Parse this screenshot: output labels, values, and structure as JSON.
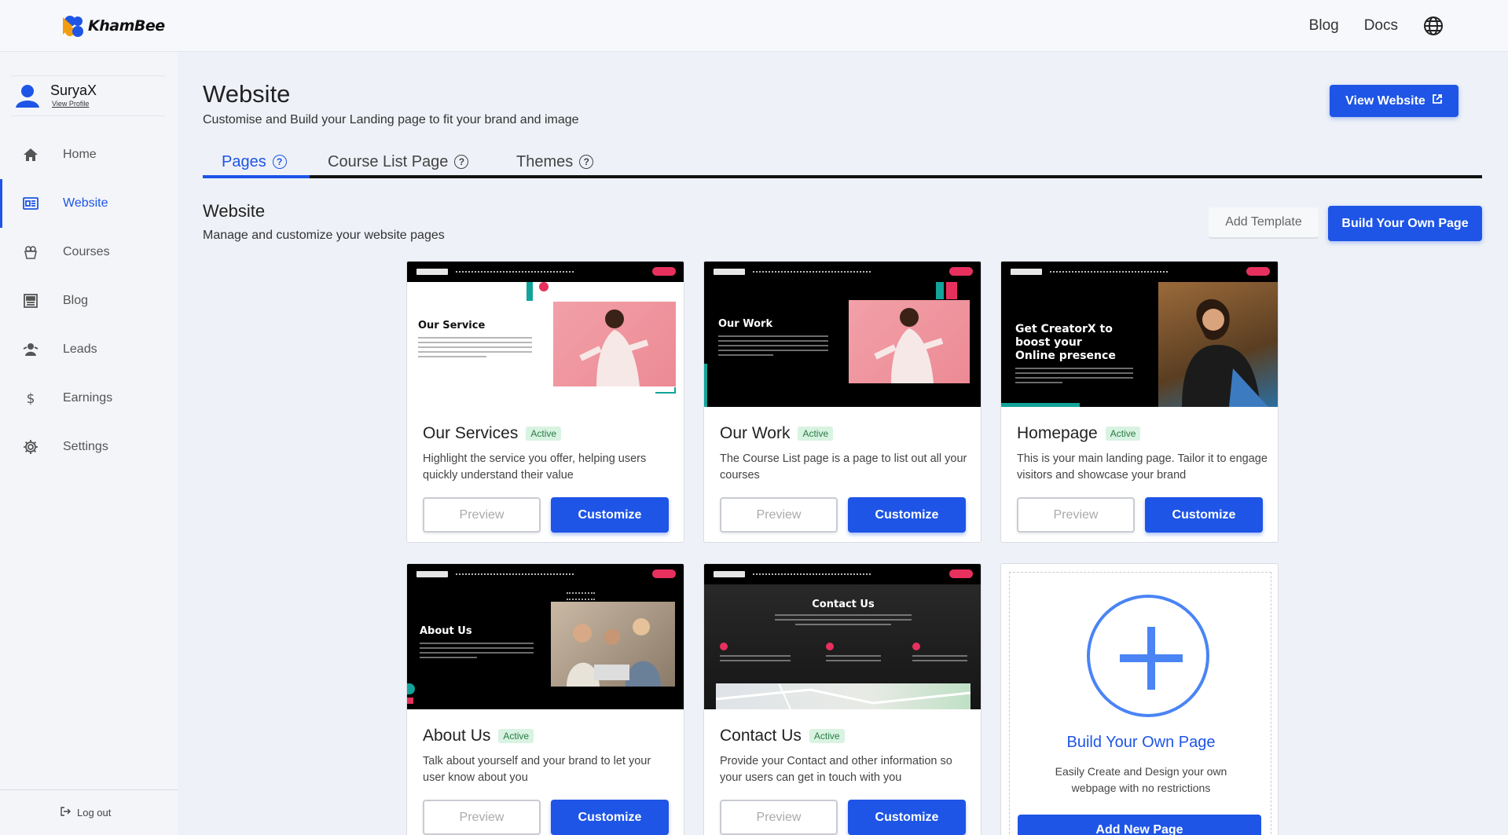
{
  "brand": {
    "name": "KhamBee"
  },
  "topnav": {
    "blog": "Blog",
    "docs": "Docs",
    "language_icon": "globe-icon"
  },
  "profile": {
    "name": "SuryaX",
    "link": "View Profile"
  },
  "sidebar": {
    "items": [
      {
        "label": "Home",
        "icon": "home-icon",
        "active": false
      },
      {
        "label": "Website",
        "icon": "website-icon",
        "active": true
      },
      {
        "label": "Courses",
        "icon": "courses-icon",
        "active": false
      },
      {
        "label": "Blog",
        "icon": "blog-icon",
        "active": false
      },
      {
        "label": "Leads",
        "icon": "leads-icon",
        "active": false
      },
      {
        "label": "Earnings",
        "icon": "dollar-icon",
        "active": false
      },
      {
        "label": "Settings",
        "icon": "gear-icon",
        "active": false
      }
    ],
    "logout": "Log out"
  },
  "header": {
    "title": "Website",
    "subtitle": "Customise and Build your Landing page to fit your brand and image",
    "view_website": "View Website"
  },
  "tabs": [
    {
      "label": "Pages",
      "active": true
    },
    {
      "label": "Course List Page",
      "active": false
    },
    {
      "label": "Themes",
      "active": false
    }
  ],
  "section": {
    "title": "Website",
    "subtitle": "Manage and customize your website pages",
    "add_template": "Add Template",
    "build_own": "Build Your Own Page"
  },
  "cards": [
    {
      "title": "Our Services",
      "badge": "Active",
      "description": "Highlight the service you offer, helping users quickly understand their value",
      "thumb_heading": "Our Service",
      "preview": "Preview",
      "customize": "Customize"
    },
    {
      "title": "Our Work",
      "badge": "Active",
      "description": "The Course List page is a page to list out all your courses",
      "thumb_heading": "Our Work",
      "preview": "Preview",
      "customize": "Customize"
    },
    {
      "title": "Homepage",
      "badge": "Active",
      "description": "This is your main landing page. Tailor it to engage visitors and showcase your brand",
      "thumb_heading": "Get CreatorX to boost your Online presence",
      "preview": "Preview",
      "customize": "Customize"
    },
    {
      "title": "About Us",
      "badge": "Active",
      "description": "Talk about yourself and your brand to let your user know about you",
      "thumb_heading": "About Us",
      "preview": "Preview",
      "customize": "Customize"
    },
    {
      "title": "Contact Us",
      "badge": "Active",
      "description": "Provide your Contact and other information so your users can get in touch with you",
      "thumb_heading": "Contact Us",
      "preview": "Preview",
      "customize": "Customize"
    }
  ],
  "new_page": {
    "title": "Build Your Own Page",
    "description": "Easily Create and Design your own webpage with no restrictions",
    "button": "Add New Page"
  },
  "colors": {
    "accent": "#1e55e6",
    "badge_bg": "#d8f3e1",
    "badge_text": "#2a7a45",
    "pink": "#e8305e",
    "teal": "#12a39a"
  }
}
